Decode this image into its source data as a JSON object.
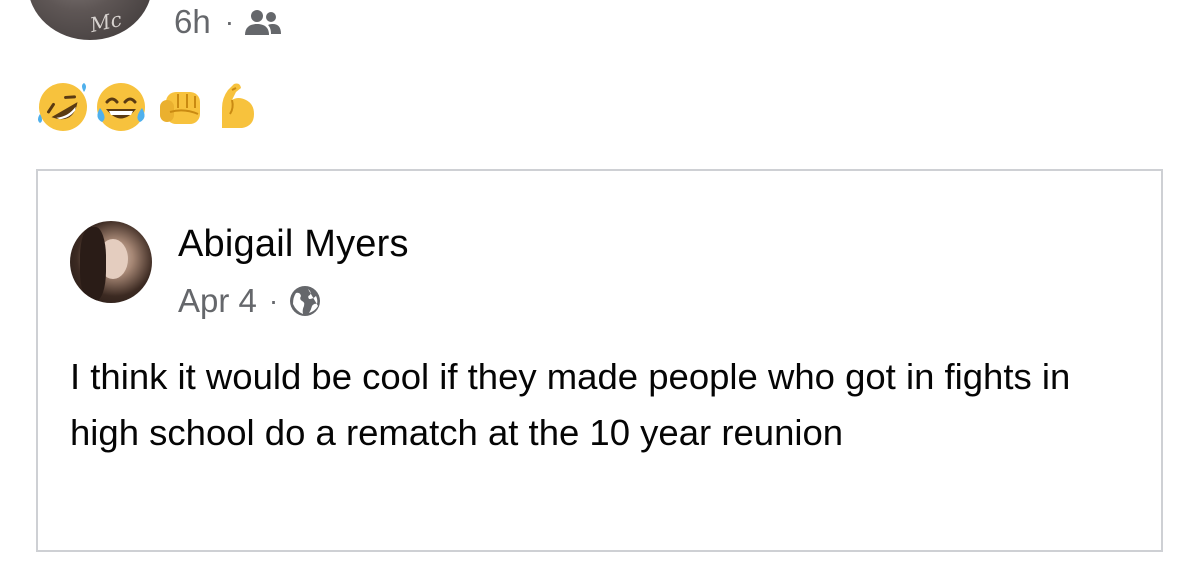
{
  "top_post": {
    "time": "6h",
    "separator": "·",
    "audience_icon": "friends-icon"
  },
  "reaction_emojis": [
    {
      "name": "rolling-on-floor-laughing-emoji",
      "char": "🤣"
    },
    {
      "name": "tears-of-joy-emoji",
      "char": "😂"
    },
    {
      "name": "oncoming-fist-emoji",
      "char": "👊"
    },
    {
      "name": "flexed-biceps-emoji",
      "char": "💪"
    }
  ],
  "shared_post": {
    "author": "Abigail Myers",
    "date": "Apr 4",
    "separator": "·",
    "audience_icon": "globe-icon",
    "text": "I think it would be cool if they made people who got in fights in high school do a rematch at the 10 year reunion"
  },
  "colors": {
    "meta_gray": "#65676b",
    "text": "#050505",
    "card_border": "#ced0d4",
    "emoji_yellow": "#f7c23d"
  }
}
